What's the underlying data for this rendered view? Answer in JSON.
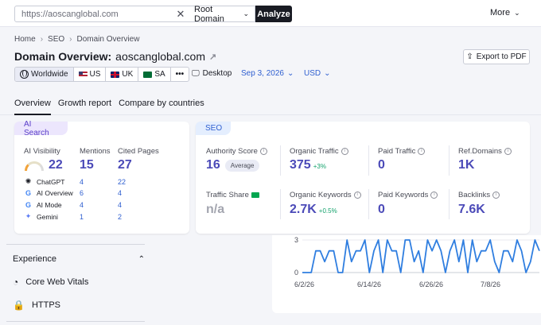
{
  "topbar": {
    "search_value": "https://aoscanglobal.com",
    "root_select": "Root Domain",
    "analyze_label": "Analyze",
    "more_label": "More"
  },
  "breadcrumb": [
    "Home",
    "SEO",
    "Domain Overview"
  ],
  "title": {
    "prefix": "Domain Overview:",
    "domain": "aoscanglobal.com"
  },
  "export_label": "Export to PDF",
  "databases": [
    {
      "label": "Worldwide",
      "icon": "globe-icon"
    },
    {
      "label": "US",
      "icon": "flag-us"
    },
    {
      "label": "UK",
      "icon": "flag-uk"
    },
    {
      "label": "SA",
      "icon": "flag-sa"
    },
    {
      "label": "•••",
      "icon": "more-icon"
    }
  ],
  "device_label": "Desktop",
  "date_label": "Sep 3, 2026",
  "currency_label": "USD",
  "tabs": [
    "Overview",
    "Growth report",
    "Compare by countries"
  ],
  "ai_search": {
    "chip": "AI Search",
    "headers": [
      "AI Visibility",
      "Mentions",
      "Cited Pages"
    ],
    "totals": [
      "22",
      "15",
      "27"
    ],
    "visibility_fraction": 0.22,
    "rows": [
      {
        "name": "ChatGPT",
        "mentions": "4",
        "cited": "22"
      },
      {
        "name": "AI Overview",
        "mentions": "6",
        "cited": "4"
      },
      {
        "name": "AI Mode",
        "mentions": "4",
        "cited": "4"
      },
      {
        "name": "Gemini",
        "mentions": "1",
        "cited": "2"
      }
    ]
  },
  "seo": {
    "chip": "SEO",
    "authority_label": "Authority Score",
    "authority_value": "16",
    "authority_badge": "Average",
    "organic_traffic_label": "Organic Traffic",
    "organic_traffic_value": "375",
    "organic_traffic_delta": "+3%",
    "paid_traffic_label": "Paid Traffic",
    "paid_traffic_value": "0",
    "ref_domains_label": "Ref.Domains",
    "ref_domains_value": "1K",
    "traffic_share_label": "Traffic Share",
    "traffic_share_value": "n/a",
    "organic_keywords_label": "Organic Keywords",
    "organic_keywords_value": "2.7K",
    "organic_keywords_delta": "+0.5%",
    "paid_keywords_label": "Paid Keywords",
    "paid_keywords_value": "0",
    "backlinks_label": "Backlinks",
    "backlinks_value": "7.6K"
  },
  "side": {
    "heading": "Experience",
    "items": [
      "Core Web Vitals",
      "HTTPS"
    ]
  },
  "chart_data": {
    "type": "line",
    "y_ticks": [
      "3",
      "0"
    ],
    "ylim": [
      0,
      3
    ],
    "x_ticks": [
      "6/2/26",
      "6/14/26",
      "6/26/26",
      "7/8/26"
    ],
    "series": [
      {
        "values": [
          0,
          0,
          0,
          2,
          2,
          1,
          2,
          2,
          0,
          0,
          3,
          1,
          2,
          2,
          3,
          0,
          2,
          3,
          0,
          3,
          2,
          2,
          0,
          3,
          3,
          1,
          2,
          0,
          3,
          2,
          3,
          2,
          0,
          2,
          3,
          1,
          3,
          0,
          3,
          1,
          2,
          2,
          3,
          1,
          0,
          2,
          2,
          1,
          3,
          2,
          0,
          1,
          3,
          2
        ]
      }
    ],
    "color": "#2f7ee0"
  }
}
